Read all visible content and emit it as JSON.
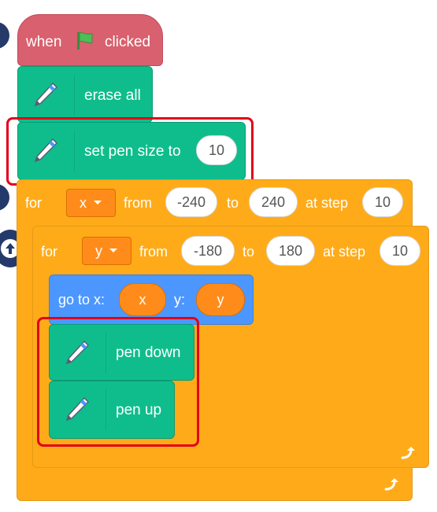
{
  "hat_block": {
    "when": "when",
    "clicked": "clicked",
    "flag_icon": "green-flag-icon"
  },
  "erase_all": {
    "label": "erase all"
  },
  "set_pen_size": {
    "label": "set pen size to",
    "value": "10"
  },
  "outer_loop": {
    "for": "for",
    "variable": "x",
    "from": "from",
    "start": "-240",
    "to": "to",
    "end": "240",
    "at_step": "at step",
    "step": "10"
  },
  "inner_loop": {
    "for": "for",
    "variable": "y",
    "from": "from",
    "start": "-180",
    "to": "to",
    "end": "180",
    "at_step": "at step",
    "step": "10"
  },
  "goto_block": {
    "label_x": "go to x:",
    "x_value": "x",
    "label_y": "y:",
    "y_value": "y"
  },
  "pen_down": {
    "label": "pen down"
  },
  "pen_up": {
    "label": "pen up"
  },
  "colors": {
    "events": "#d9606e",
    "pen": "#0fbd8c",
    "control": "#ffab19",
    "motion": "#4c97ff",
    "variable": "#ff8c1a",
    "highlight": "#e3001b"
  }
}
